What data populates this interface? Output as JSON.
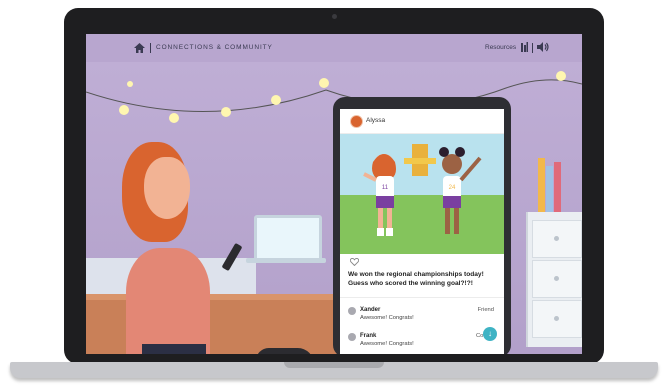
{
  "header": {
    "breadcrumb": "CONNECTIONS & COMMUNITY",
    "resources_label": "Resources"
  },
  "post": {
    "author": "Alyssa",
    "caption": "We won the regional championships today! Guess who scored the winning goal?!?!",
    "jersey_left": "11",
    "jersey_right": "24"
  },
  "comments": [
    {
      "name": "Xander",
      "text": "Awesome! Congrats!",
      "tag": "Friend"
    },
    {
      "name": "Frank",
      "text": "Awesome! Congrats!",
      "tag": "Cousin"
    }
  ],
  "icons": {
    "home": "home-icon",
    "resources": "book-icon",
    "audio": "speaker-icon",
    "like": "heart-icon",
    "scroll": "arrow-down-icon"
  },
  "colors": {
    "accent": "#3fb3c4",
    "wall": "#b8a6cf",
    "text": "#3a3a52"
  }
}
